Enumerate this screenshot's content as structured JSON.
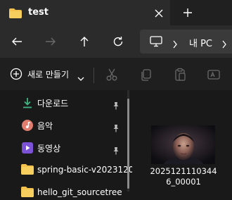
{
  "titlebar": {
    "tab_title": "test"
  },
  "address": {
    "location": "내 PC"
  },
  "toolbar": {
    "new_label": "새로 만들기"
  },
  "nav": {
    "items": [
      {
        "label": "다운로드",
        "icon": "download-icon",
        "pinned": true
      },
      {
        "label": "음악",
        "icon": "music-icon",
        "pinned": true
      },
      {
        "label": "동영상",
        "icon": "video-icon",
        "pinned": true
      },
      {
        "label": "spring-basic-v2023120",
        "icon": "folder-icon",
        "pinned": false
      },
      {
        "label": "hello_git_sourcetree",
        "icon": "folder-icon",
        "pinned": false
      }
    ]
  },
  "file": {
    "name_line1": "2025121110344",
    "name_line2": "6_00001"
  },
  "colors": {
    "background": "#191919",
    "folder": "#f2c14e",
    "download": "#3fb37f",
    "music": "#e07d6e",
    "video": "#7b52d6"
  }
}
